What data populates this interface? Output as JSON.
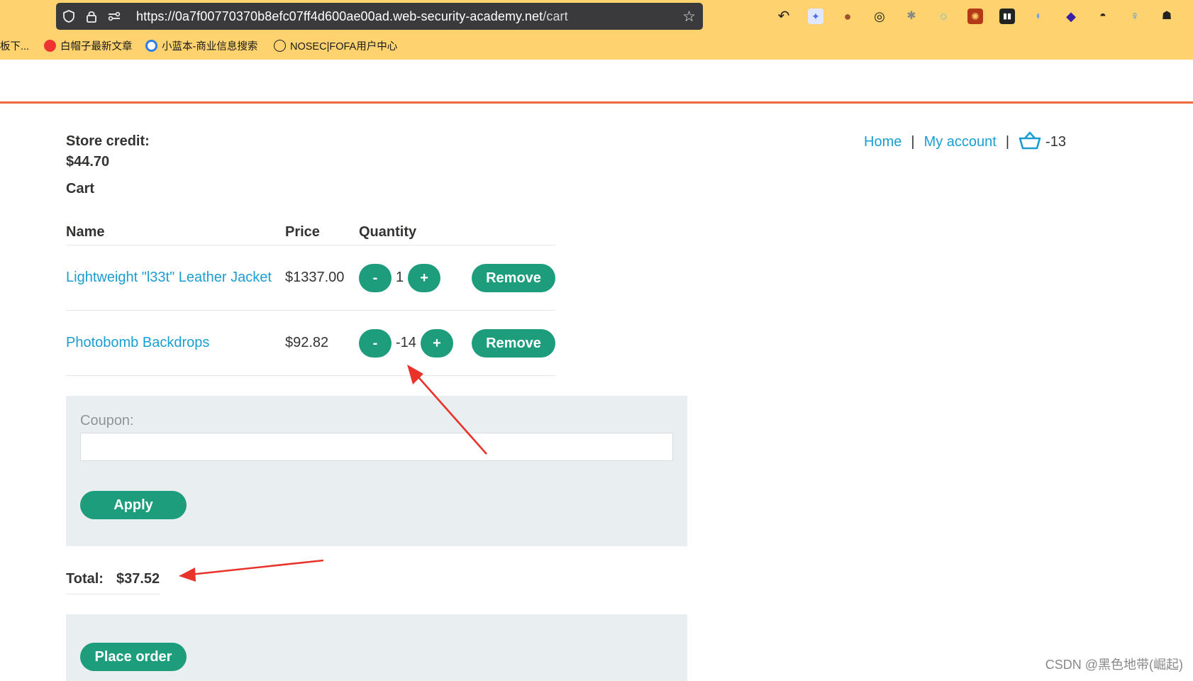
{
  "browser": {
    "url_main": "https://0a7f00770370b8efc07ff4d600ae00ad.web-security-academy.net",
    "url_path": "/cart",
    "bookmarks": [
      {
        "label": "板下...",
        "icon": "none"
      },
      {
        "label": "白帽子最新文章",
        "icon": "fire-icon"
      },
      {
        "label": "小蓝本-商业信息搜索",
        "icon": "q-icon"
      },
      {
        "label": "NOSEC|FOFA用户中心",
        "icon": "globe-icon"
      }
    ]
  },
  "nav": {
    "home": "Home",
    "sep": "|",
    "account": "My account",
    "cart_count": "-13"
  },
  "store_credit": {
    "label": "Store credit:",
    "value": "$44.70"
  },
  "cart": {
    "title": "Cart",
    "headers": [
      "Name",
      "Price",
      "Quantity"
    ],
    "items": [
      {
        "name": "Lightweight \"l33t\" Leather Jacket",
        "price": "$1337.00",
        "qty": "1"
      },
      {
        "name": "Photobomb Backdrops",
        "price": "$92.82",
        "qty": "-14"
      }
    ],
    "minus": "-",
    "plus": "+",
    "remove": "Remove"
  },
  "coupon": {
    "label": "Coupon:",
    "value": "",
    "apply": "Apply"
  },
  "total": {
    "label": "Total:",
    "value": "$37.52"
  },
  "place_order": "Place order",
  "watermark": "CSDN @黑色地带(崛起)",
  "colors": {
    "accent": "#1d9d7c",
    "link": "#1a9ed1",
    "header_line": "#ee6a3e",
    "browser_toolbar": "#fdd26f",
    "annotation": "#e8332a"
  }
}
